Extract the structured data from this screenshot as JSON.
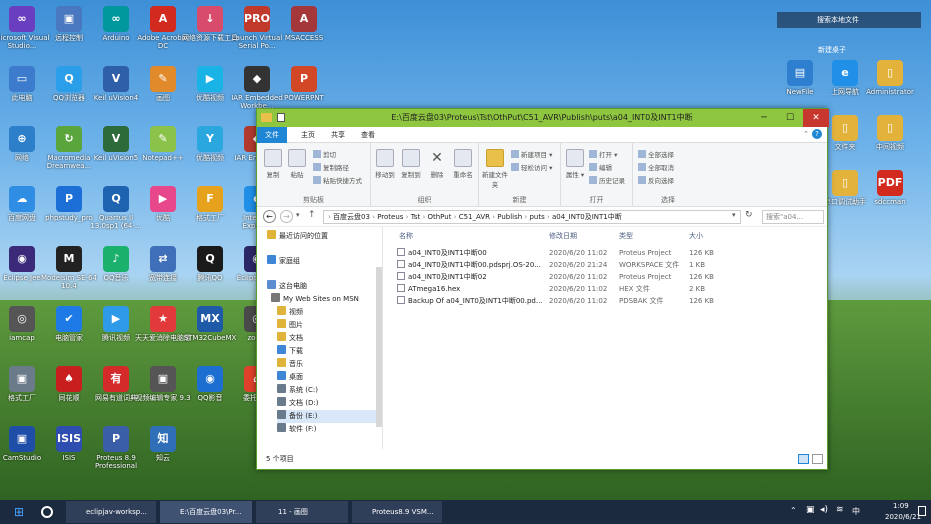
{
  "desktop": {
    "search": "搜索本地文件",
    "folder_group": "新建桌子",
    "icons": [
      {
        "label": "Microsoft Visual Studio...",
        "color": "#6a3fbf",
        "glyph": "∞"
      },
      {
        "label": "远程控制",
        "color": "#4a78c0",
        "glyph": "▣"
      },
      {
        "label": "Arduino",
        "color": "#00979d",
        "glyph": "∞"
      },
      {
        "label": "Adobe Acrobat DC",
        "color": "#d22a1e",
        "glyph": "A"
      },
      {
        "label": "网络资源下载工具",
        "color": "#d84b6b",
        "glyph": "↓"
      },
      {
        "label": "Launch Virtual Serial Po...",
        "color": "#c0392b",
        "glyph": "PRO"
      },
      {
        "label": "MSACCESS",
        "color": "#a4373a",
        "glyph": "A"
      },
      {
        "label": "此电脑",
        "color": "#3d7ccc",
        "glyph": "▭"
      },
      {
        "label": "QQ浏览器",
        "color": "#2a9ee8",
        "glyph": "Q"
      },
      {
        "label": "Keil uVision4",
        "color": "#2f5fa8",
        "glyph": "V"
      },
      {
        "label": "画图",
        "color": "#e08a2c",
        "glyph": "✎"
      },
      {
        "label": "优酷视频",
        "color": "#1ab3e6",
        "glyph": "▶"
      },
      {
        "label": "IAR Embedded Workbe...",
        "color": "#333333",
        "glyph": "◆"
      },
      {
        "label": "POWERPNT",
        "color": "#d24726",
        "glyph": "P"
      },
      {
        "label": "网络",
        "color": "#2c7fc8",
        "glyph": "⊕"
      },
      {
        "label": "Macromedia Dreamwea...",
        "color": "#5aa63d",
        "glyph": "↻"
      },
      {
        "label": "Keil uVision5",
        "color": "#2d6b3a",
        "glyph": "V"
      },
      {
        "label": "Notepad++",
        "color": "#8bc34a",
        "glyph": "✎"
      },
      {
        "label": "优酷视频",
        "color": "#2ba7e0",
        "glyph": "Y"
      },
      {
        "label": "IAR Embed...",
        "color": "#b33a2f",
        "glyph": "◆"
      },
      {
        "label": "回收站",
        "color": "#6b8fb5",
        "glyph": "♻"
      },
      {
        "label": "百度网盘",
        "color": "#2f8de4",
        "glyph": "☁"
      },
      {
        "label": "phpstudy_pro",
        "color": "#1b6fd6",
        "glyph": "P"
      },
      {
        "label": "Quartus II 13.0sp1 (64-...",
        "color": "#1e63b0",
        "glyph": "Q"
      },
      {
        "label": "优酷",
        "color": "#e8478b",
        "glyph": "▶"
      },
      {
        "label": "格式工厂",
        "color": "#e6a21d",
        "glyph": "F"
      },
      {
        "label": "Internet Explorer",
        "color": "#1f8fe8",
        "glyph": "e"
      },
      {
        "label": "Tina",
        "color": "#b0161e",
        "glyph": "T"
      },
      {
        "label": "Eclipse Jee",
        "color": "#3b2a7a",
        "glyph": "◉"
      },
      {
        "label": "Modelsim SE-64 10.4",
        "color": "#222222",
        "glyph": "M"
      },
      {
        "label": "QQ音乐",
        "color": "#1bb16c",
        "glyph": "♪"
      },
      {
        "label": "宽带连接",
        "color": "#3e6fb8",
        "glyph": "⇄"
      },
      {
        "label": "腾讯QQ",
        "color": "#1a1a1a",
        "glyph": "Q"
      },
      {
        "label": "Eclipse Cpp",
        "color": "#2c2766",
        "glyph": "◉"
      },
      {
        "label": "千牛工作台",
        "color": "#1e86e3",
        "glyph": "千"
      },
      {
        "label": "iamcap",
        "color": "#555555",
        "glyph": "◎"
      },
      {
        "label": "电脑管家",
        "color": "#1d7ae6",
        "glyph": "✔"
      },
      {
        "label": "腾讯视频",
        "color": "#2f9ae8",
        "glyph": "▶"
      },
      {
        "label": "天天爱消除电脑版",
        "color": "#e23a3a",
        "glyph": "★"
      },
      {
        "label": "STM32CubeMX",
        "color": "#1e5aa8",
        "glyph": "MX"
      },
      {
        "label": "zoom",
        "color": "#4a4a4a",
        "glyph": "◎"
      },
      {
        "label": "软件管理",
        "color": "#3cb371",
        "glyph": "▦"
      },
      {
        "label": "格式工厂",
        "color": "#6c7b8a",
        "glyph": "▣"
      },
      {
        "label": "同花顺",
        "color": "#c81e1e",
        "glyph": "♠"
      },
      {
        "label": "网易有道词典",
        "color": "#d42a2a",
        "glyph": "有"
      },
      {
        "label": "视频编辑专家 9.3",
        "color": "#555555",
        "glyph": "▣"
      },
      {
        "label": "QQ影音",
        "color": "#1c6fd1",
        "glyph": "◉"
      },
      {
        "label": "委托交易",
        "color": "#e0412b",
        "glyph": "⌂"
      },
      {
        "label": "分区助手 8.3",
        "color": "#2f8e4f",
        "glyph": "◔"
      },
      {
        "label": "CamStudio",
        "color": "#1f4ea8",
        "glyph": "▣"
      },
      {
        "label": "ISIS",
        "color": "#2d4db0",
        "glyph": "ISIS"
      },
      {
        "label": "Proteus 8.9 Professional",
        "color": "#3a5fa8",
        "glyph": "P"
      },
      {
        "label": "知云",
        "color": "#2f6fb8",
        "glyph": "知"
      }
    ],
    "right_icons": [
      {
        "label": "NewFile",
        "color": "#2f7fd0",
        "glyph": "▤"
      },
      {
        "label": "上网导航",
        "color": "#1f8fe8",
        "glyph": "e"
      },
      {
        "label": "Administrator",
        "color": "#e2b23b",
        "glyph": "▯"
      },
      {
        "label": "文件夹",
        "color": "#e2b23b",
        "glyph": "▯"
      },
      {
        "label": "中间视频",
        "color": "#e2b23b",
        "glyph": "▯"
      },
      {
        "label": "串口调试助手",
        "color": "#e2b23b",
        "glyph": "▯"
      },
      {
        "label": "sdccman",
        "color": "#d22a1e",
        "glyph": "PDF"
      }
    ]
  },
  "window": {
    "title": "E:\\百度云盘03\\Proteus\\Tst\\OthPut\\C51_AVR\\Publish\\puts\\a04_INT0及INT1中断",
    "tabs": [
      "文件",
      "主页",
      "共享",
      "查看"
    ],
    "ribbon": {
      "clipboard": {
        "label": "剪贴板",
        "copy": "复制",
        "paste": "粘贴",
        "cut": "剪切",
        "copy_path": "复制路径",
        "paste_shortcut": "粘贴快捷方式"
      },
      "organize": {
        "label": "组织",
        "move_to": "移动到",
        "copy_to": "复制到",
        "delete": "删除",
        "rename": "重命名"
      },
      "new": {
        "label": "新建",
        "new_folder": "新建文件夹",
        "new_item": "新建项目",
        "easy_access": "轻松访问"
      },
      "open": {
        "label": "打开",
        "properties": "属性",
        "open": "打开",
        "edit": "编辑",
        "history": "历史记录"
      },
      "select": {
        "label": "选择",
        "select_all": "全部选择",
        "select_none": "全部取消",
        "invert": "反向选择"
      }
    },
    "breadcrumb": [
      "百度云盘03",
      "Proteus",
      "Tst",
      "OthPut",
      "C51_AVR",
      "Publish",
      "puts",
      "a04_INT0及INT1中断"
    ],
    "search_placeholder": "搜索\"a04...",
    "nav": [
      "最近访问的位置",
      "家庭组",
      "这台电脑",
      "My Web Sites on MSN",
      "视频",
      "图片",
      "文档",
      "下载",
      "音乐",
      "桌面",
      "系统 (C:)",
      "文档 (D:)",
      "备份 (E:)",
      "软件 (F:)"
    ],
    "columns": [
      "名称",
      "修改日期",
      "类型",
      "大小"
    ],
    "files": [
      {
        "name": "a04_INT0及INT1中断00",
        "date": "2020/6/20 11:02",
        "type": "Proteus Project",
        "size": "126 KB"
      },
      {
        "name": "a04_INT0及INT1中断00.pdsprj.OS-20...",
        "date": "2020/6/20 21:24",
        "type": "WORKSPACE 文件",
        "size": "1 KB"
      },
      {
        "name": "a04_INT0及INT1中断02",
        "date": "2020/6/20 11:02",
        "type": "Proteus Project",
        "size": "126 KB"
      },
      {
        "name": "ATmega16.hex",
        "date": "2020/6/20 11:02",
        "type": "HEX 文件",
        "size": "2 KB"
      },
      {
        "name": "Backup Of a04_INT0及INT1中断00.pd...",
        "date": "2020/6/20 11:02",
        "type": "PDSBAK 文件",
        "size": "126 KB"
      }
    ],
    "status": "5 个项目"
  },
  "taskbar": {
    "items": [
      "eclipjav-worksp...",
      "E:\\百度云盘03\\Pr...",
      "11 - 画图",
      "Proteus8.9 VSM..."
    ],
    "ime": "中",
    "time": "1:09",
    "date": "2020/6/21"
  }
}
